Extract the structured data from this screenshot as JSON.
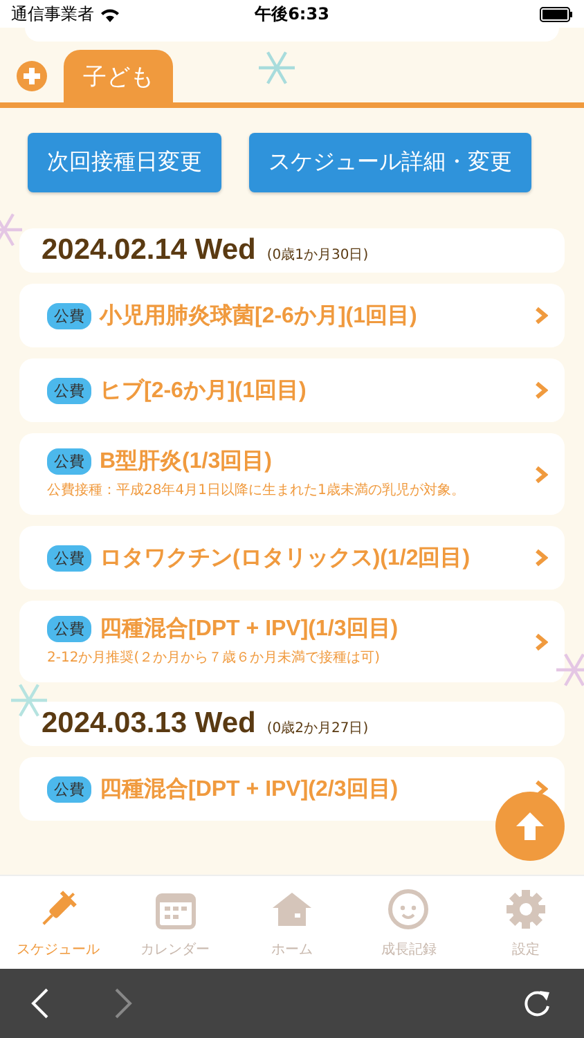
{
  "status_bar": {
    "carrier": "通信事業者",
    "time": "午後6:33"
  },
  "child_tabs": [
    {
      "label": "子ども",
      "selected": true
    }
  ],
  "actions": [
    "次回接種日変更",
    "スケジュール詳細・変更"
  ],
  "groups": [
    {
      "date": "2024.02.14 Wed",
      "age": "(0歳1か月30日)",
      "items": [
        {
          "badge": "公費",
          "title": "小児用肺炎球菌[2-6か月](1回目)"
        },
        {
          "badge": "公費",
          "title": "ヒブ[2-6か月](1回目)"
        },
        {
          "badge": "公費",
          "title": "B型肝炎(1/3回目)",
          "note": "公費接種：平成28年4月1日以降に生まれた1歳未満の乳児が対象。"
        },
        {
          "badge": "公費",
          "title": "ロタワクチン(ロタリックス)(1/2回目)"
        },
        {
          "badge": "公費",
          "title": "四種混合[DPT + IPV](1/3回目)",
          "note": "2-12か月推奨(２か月から７歳６か月未満で接種は可)"
        }
      ]
    },
    {
      "date": "2024.03.13 Wed",
      "age": "(0歳2か月27日)",
      "items": [
        {
          "badge": "公費",
          "title": "四種混合[DPT + IPV](2/3回目)"
        }
      ]
    }
  ],
  "tab_bar": [
    {
      "kind": "syringe",
      "label": "スケジュール",
      "selected": true
    },
    {
      "kind": "calendar",
      "label": "カレンダー",
      "selected": false
    },
    {
      "kind": "home",
      "label": "ホーム",
      "selected": false
    },
    {
      "kind": "face",
      "label": "成長記録",
      "selected": false
    },
    {
      "kind": "gear",
      "label": "設定",
      "selected": false
    }
  ],
  "browser_bar": {
    "back_disabled": false,
    "forward_disabled": true
  }
}
